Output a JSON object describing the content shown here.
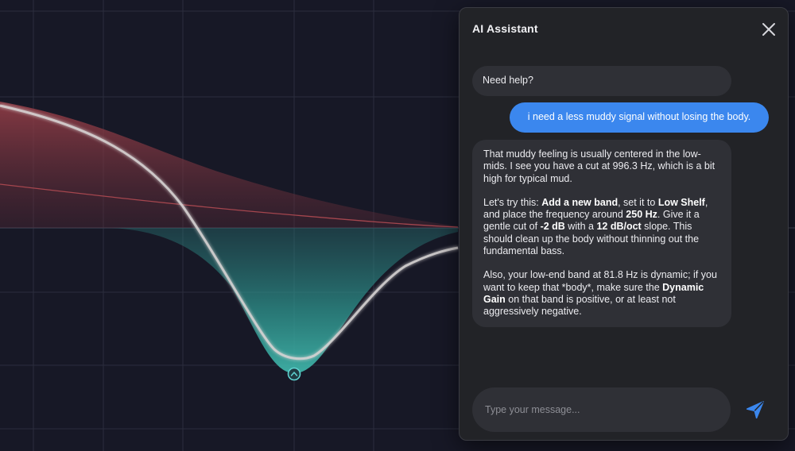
{
  "eq": {
    "colors": {
      "background": "#171826",
      "grid": "#2b2d3d",
      "zero_line": "#3d4052",
      "shelf_fill": "#8a3a44",
      "shelf_line": "#b04a52",
      "cut_fill": "#2f9c94",
      "response_curve": "#d8d4d4",
      "node": "#5fd3d0"
    },
    "node_icon": "band-handle-icon"
  },
  "assistant": {
    "title": "AI Assistant",
    "close_icon": "close-icon",
    "messages": {
      "help": "Need help?",
      "user": "i need a less muddy signal without losing the body.",
      "reply": {
        "p1": {
          "t1": "That muddy feeling is usually centered in the low-mids. I see you have a cut at 996.3 Hz, which is a bit high for typical mud."
        },
        "p2": {
          "t1": "Let's try this: ",
          "b1": "Add a new band",
          "t2": ", set it to ",
          "b2": "Low Shelf",
          "t3": ", and place the frequency around ",
          "b3": "250 Hz",
          "t4": ". Give it a gentle cut of ",
          "b4": "-2 dB",
          "t5": " with a ",
          "b5": "12 dB/oct",
          "t6": " slope. This should clean up the body without thinning out the fundamental bass."
        },
        "p3": {
          "t1": "Also, your low-end band at 81.8 Hz is dynamic; if you want to keep that *body*, make sure the ",
          "b1": "Dynamic Gain",
          "t2": " on that band is positive, or at least not aggressively negative."
        }
      }
    },
    "input": {
      "placeholder": "Type your message...",
      "value": ""
    },
    "send_icon": "send-icon",
    "colors": {
      "panel": "#222327",
      "bubble": "#2f3036",
      "user_bubble": "#3b87ee",
      "send_icon": "#3b87ee"
    }
  }
}
